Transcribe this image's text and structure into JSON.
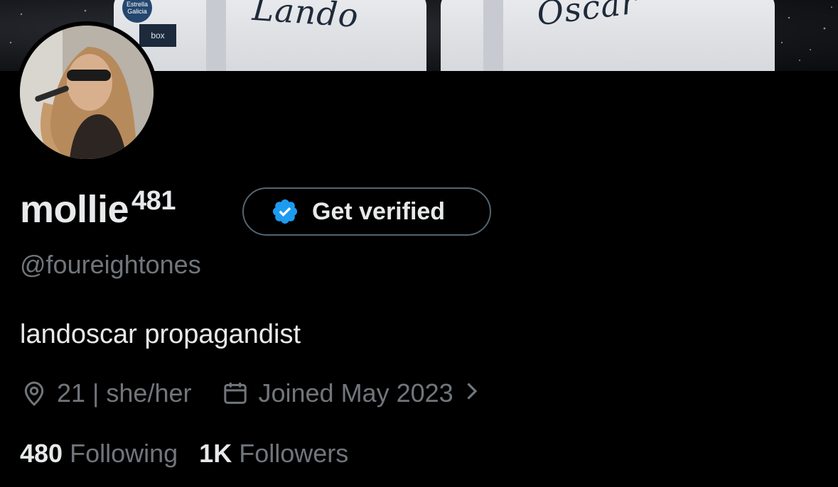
{
  "banner": {
    "left_name": "Lando",
    "right_name": "Oscar",
    "patch_text": "Estrella Galicia",
    "sponsor_text": "box"
  },
  "profile": {
    "display_name": "mollie",
    "name_suffix": "481",
    "verify_label": "Get verified",
    "handle": "@foureightones",
    "bio": "landoscar propagandist",
    "location": "21 | she/her",
    "joined": "Joined May 2023",
    "following_count": "480",
    "following_label": "Following",
    "followers_count": "1K",
    "followers_label": "Followers"
  },
  "icons": {
    "verified": "verified-badge-icon",
    "location": "location-pin-icon",
    "calendar": "calendar-icon",
    "chevron": "chevron-right-icon"
  },
  "colors": {
    "background": "#000000",
    "primary_text": "#e7e9ea",
    "secondary_text": "#71767b",
    "verified_blue": "#1d9bf0",
    "button_border": "#536471"
  }
}
